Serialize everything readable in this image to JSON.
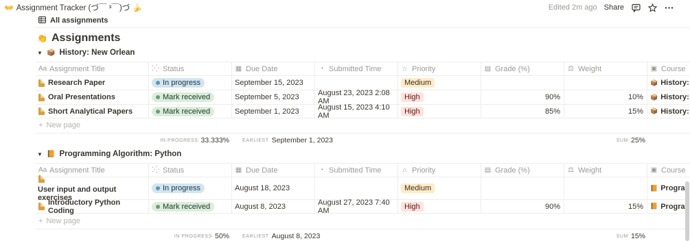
{
  "topbar": {
    "crumb_emoji_left": "👐",
    "crumb_title": "Assignment Tracker (づ￣ ³￣)づ",
    "crumb_emoji_right": "🍌",
    "edited": "Edited 2m ago",
    "share": "Share",
    "icons": [
      "comment-icon",
      "star-icon",
      "more-icon"
    ]
  },
  "view": {
    "label": "All assignments",
    "icon": "table-icon"
  },
  "database": {
    "title": "Assignments",
    "icon": "👏"
  },
  "columns": [
    "Assignment Title",
    "Status",
    "Due Date",
    "Submitted Time",
    "Priority",
    "Grade (%)",
    "Weight",
    "Course"
  ],
  "groups": [
    {
      "name": "History: New Orlean",
      "icon": "📦",
      "rows": [
        {
          "title": "Research Paper",
          "status": "In progress",
          "due": "September 15, 2023",
          "submitted": "",
          "priority": "Medium",
          "grade": "",
          "weight": "",
          "course": "History:"
        },
        {
          "title": "Oral Presentations",
          "status": "Mark received",
          "due": "September 5, 2023",
          "submitted": "August 23, 2023 2:08 AM",
          "priority": "High",
          "grade": "90%",
          "weight": "10%",
          "course": "History:"
        },
        {
          "title": "Short Analytical Papers",
          "status": "Mark received",
          "due": "September 1, 2023",
          "submitted": "August 15, 2023 4:10 AM",
          "priority": "High",
          "grade": "85%",
          "weight": "15%",
          "course": "History:"
        }
      ],
      "new_page": "New page",
      "calc": {
        "in_progress_label": "IN PROGRESS",
        "in_progress": "33.333%",
        "earliest_label": "EARLIEST",
        "earliest": "September 1, 2023",
        "sum_label": "SUM",
        "sum": "25%"
      }
    },
    {
      "name": "Programming Algorithm: Python",
      "icon": "📙",
      "rows": [
        {
          "title": "User input and output exercises",
          "status": "In progress",
          "due": "August 18, 2023",
          "submitted": "",
          "priority": "Medium",
          "grade": "",
          "weight": "",
          "course": "Prograr"
        },
        {
          "title": "Introductory Python Coding",
          "status": "Mark received",
          "due": "August 8, 2023",
          "submitted": "August 27, 2023 7:40 AM",
          "priority": "High",
          "grade": "90%",
          "weight": "15%",
          "course": "Prograr"
        }
      ],
      "new_page": "New page",
      "calc": {
        "in_progress_label": "IN PROGRESS",
        "in_progress": "50%",
        "earliest_label": "EARLIEST",
        "earliest": "August 8, 2023",
        "sum_label": "SUM",
        "sum": "15%"
      }
    }
  ],
  "colors": {
    "in_progress_bg": "#d3e5ef",
    "mark_received_bg": "#dbeddb",
    "medium_bg": "#fdecc8",
    "high_bg": "#ffe2dd"
  }
}
